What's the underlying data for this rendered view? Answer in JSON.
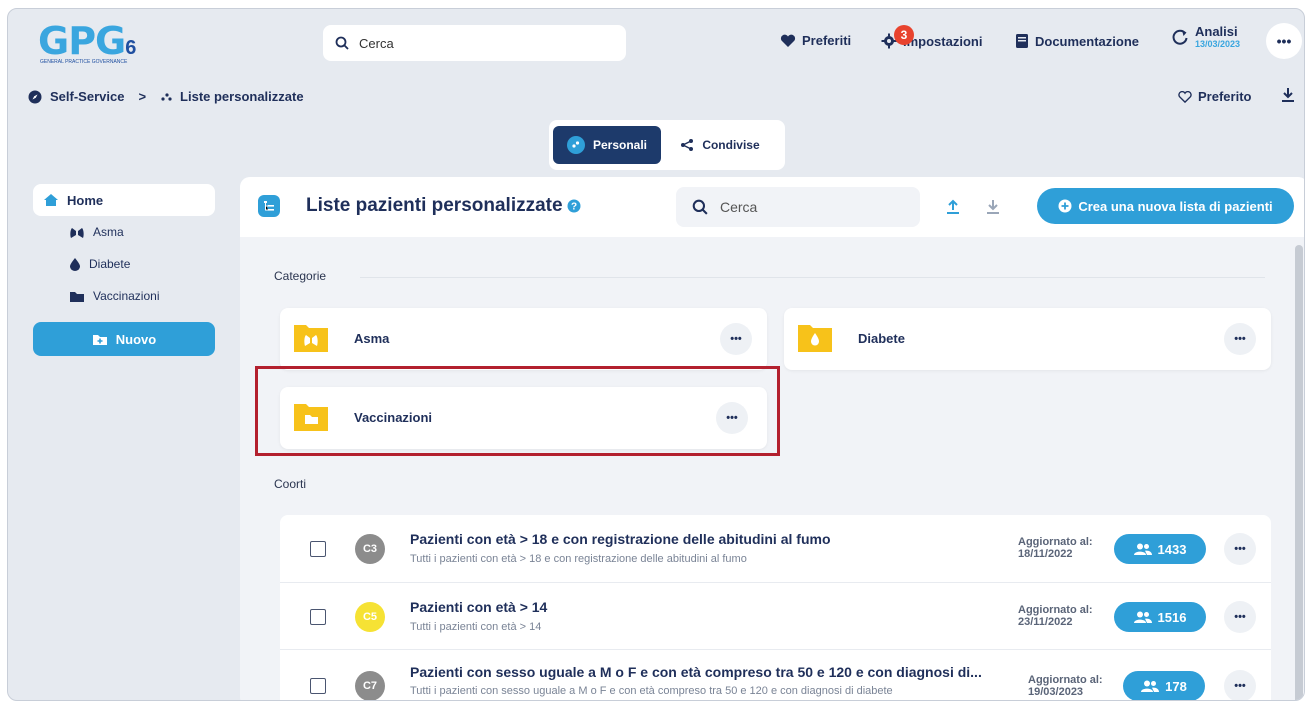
{
  "header": {
    "logo_text": "GPG",
    "logo_version": "6",
    "logo_subtitle": "GENERAL PRACTICE GOVERNANCE",
    "search_placeholder": "Cerca",
    "preferiti": "Preferiti",
    "impostazioni": "Impostazioni",
    "impostazioni_badge": "3",
    "documentazione": "Documentazione",
    "analisi": "Analisi",
    "analisi_date": "13/03/2023",
    "more": "•••"
  },
  "breadcrumb": {
    "root": "Self-Service",
    "separator": ">",
    "current": "Liste personalizzate"
  },
  "preferito": "Preferito",
  "tabs": {
    "personali": "Personali",
    "condivise": "Condivise"
  },
  "sidebar": {
    "home": "Home",
    "items": [
      "Asma",
      "Diabete",
      "Vaccinazioni"
    ],
    "nuovo": "Nuovo"
  },
  "main": {
    "title": "Liste pazienti personalizzate",
    "search_placeholder": "Cerca",
    "create_button": "Crea una nuova lista di pazienti",
    "categorie_label": "Categorie",
    "coorti_label": "Coorti",
    "categories": [
      {
        "label": "Asma",
        "more": "•••"
      },
      {
        "label": "Diabete",
        "more": "•••"
      },
      {
        "label": "Vaccinazioni",
        "more": "•••"
      }
    ],
    "updated_label": "Aggiornato al:",
    "cohorts": [
      {
        "code": "C3",
        "title": "Pazienti con età > 18 e con registrazione delle abitudini al fumo",
        "subtitle": "Tutti i pazienti con età > 18 e con registrazione delle abitudini al fumo",
        "updated": "18/11/2022",
        "count": "1433",
        "avatar_color": "#8c8c8c",
        "more": "•••"
      },
      {
        "code": "C5",
        "title": "Pazienti con età > 14",
        "subtitle": "Tutti i pazienti con età > 14",
        "updated": "23/11/2022",
        "count": "1516",
        "avatar_color": "#f6e234",
        "more": "•••"
      },
      {
        "code": "C7",
        "title": "Pazienti con sesso uguale a M o F e con età compreso tra 50 e 120 e con diagnosi di...",
        "subtitle": "Tutti i pazienti con sesso uguale a M o F e con età compreso tra 50 e 120 e con diagnosi di diabete",
        "updated": "19/03/2023",
        "count": "178",
        "avatar_color": "#8c8c8c",
        "more": "•••"
      }
    ]
  },
  "colors": {
    "accent": "#2f9fd8",
    "navy": "#1d3a6b",
    "folder": "#f7c21a",
    "highlight": "#b3202e",
    "badge": "#e8432e"
  }
}
